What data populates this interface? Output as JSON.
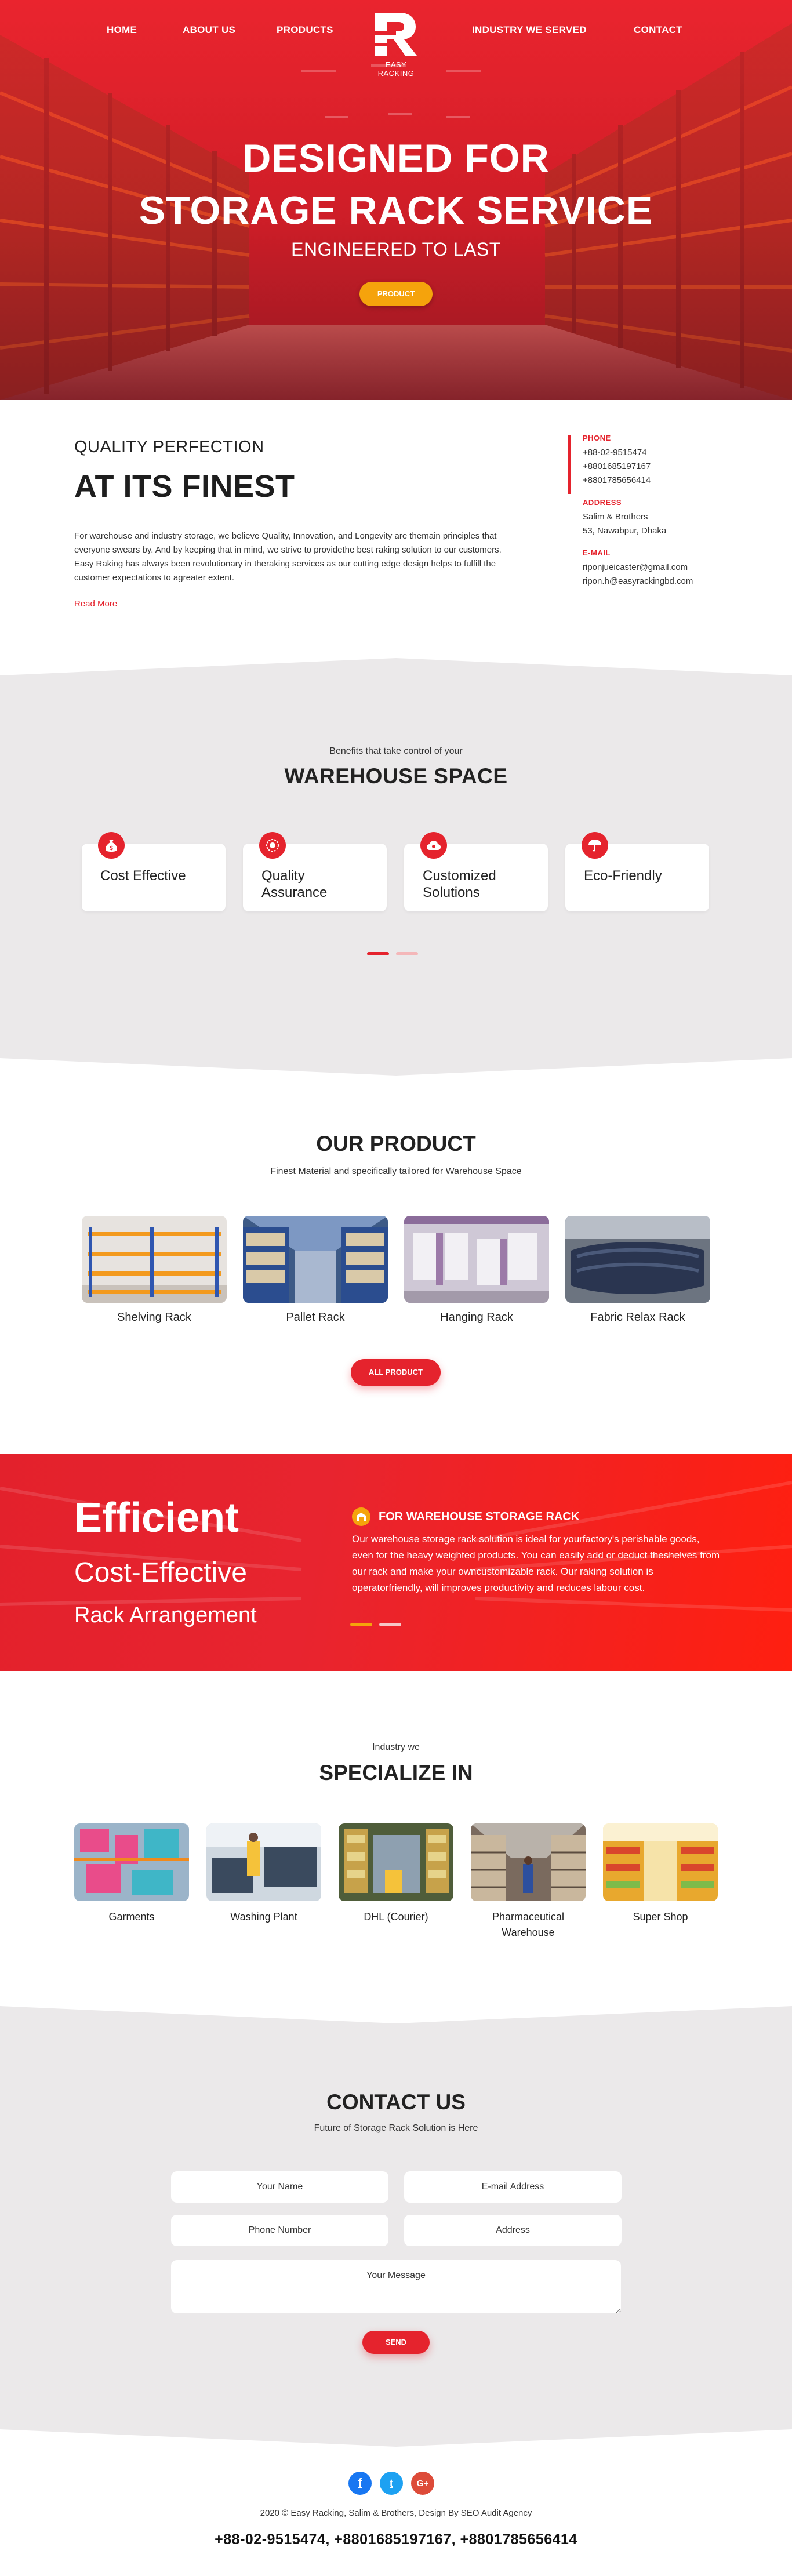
{
  "nav": {
    "items": [
      "HOME",
      "ABOUT US",
      "PRODUCTS",
      "INDUSTRY WE SERVED",
      "CONTACT"
    ],
    "logo_text": "EASY RACKING"
  },
  "hero": {
    "title_line1": "DESIGNED FOR",
    "title_line2": "STORAGE RACK SERVICE",
    "subtitle": "ENGINEERED TO LAST",
    "button": "PRODUCT"
  },
  "quality": {
    "kicker": "QUALITY PERFECTION",
    "headline": "AT ITS FINEST",
    "body": "For warehouse and industry storage, we believe Quality, Innovation, and Longevity are themain principles that everyone swears by. And by keeping that in mind, we strive to providethe best raking solution to our customers. Easy Raking has always been revolutionary in theraking services as our cutting edge design helps to fulfill the customer expectations to agreater extent.",
    "read_more": "Read More"
  },
  "contact_info": {
    "phone_label": "PHONE",
    "phones": [
      "+88-02-9515474",
      "+8801685197167",
      "+8801785656414"
    ],
    "address_label": "ADDRESS",
    "address": [
      "Salim & Brothers",
      "53, Nawabpur, Dhaka"
    ],
    "email_label": "E-MAIL",
    "emails": [
      "riponjueicaster@gmail.com",
      "ripon.h@easyrackingbd.com"
    ]
  },
  "benefits": {
    "pre": "Benefits that take control of your",
    "title": "WAREHOUSE SPACE",
    "cards": [
      {
        "line1": "Cost Effective",
        "line2": "",
        "icon": "money-bag-icon"
      },
      {
        "line1": "Quality",
        "line2": "Assurance",
        "icon": "quality-badge-icon"
      },
      {
        "line1": "Customized",
        "line2": "Solutions",
        "icon": "cloud-gear-icon"
      },
      {
        "line1": "Eco-Friendly",
        "line2": "",
        "icon": "umbrella-icon"
      }
    ]
  },
  "products": {
    "title": "OUR PRODUCT",
    "subtitle": "Finest Material and specifically tailored for Warehouse Space",
    "items": [
      "Shelving Rack",
      "Pallet Rack",
      "Hanging Rack",
      "Fabric Relax Rack"
    ],
    "button": "ALL PRODUCT"
  },
  "efficient": {
    "h1": "Efficient",
    "h2": "Cost-Effective",
    "h3": "Rack Arrangement",
    "heading": "FOR WAREHOUSE STORAGE RACK",
    "body": "Our warehouse storage rack solution is ideal for yourfactory's perishable goods, even for the heavy weighted products. You can easily add or deduct theshelves from our rack and make your owncustomizable rack. Our raking solution is operatorfriendly, will improves productivity and reduces labour cost."
  },
  "industry": {
    "pre": "Industry we",
    "title": "SPECIALIZE IN",
    "items": [
      {
        "line1": "Garments",
        "line2": ""
      },
      {
        "line1": "Washing Plant",
        "line2": ""
      },
      {
        "line1": "DHL (Courier)",
        "line2": ""
      },
      {
        "line1": "Pharmaceutical",
        "line2": "Warehouse"
      },
      {
        "line1": "Super Shop",
        "line2": ""
      }
    ]
  },
  "contact": {
    "title": "CONTACT US",
    "subtitle": "Future of Storage Rack Solution is Here",
    "name_placeholder": "Your Name",
    "email_placeholder": "E-mail Address",
    "phone_placeholder": "Phone Number",
    "address_placeholder": "Address",
    "message_placeholder": "Your Message",
    "button": "SEND"
  },
  "footer": {
    "social": [
      "f",
      "t",
      "G+"
    ],
    "copyright": "2020 © Easy Racking, Salim & Brothers, Design By SEO Audit Agency",
    "phones": "+88-02-9515474, +8801685197167, +8801785656414"
  },
  "colors": {
    "brand_red": "#e5232d",
    "accent_orange": "#f5a30c",
    "section_gray": "#ebe9ea",
    "facebook": "#1877f2",
    "twitter": "#1da1f2",
    "google": "#dd4b39"
  }
}
